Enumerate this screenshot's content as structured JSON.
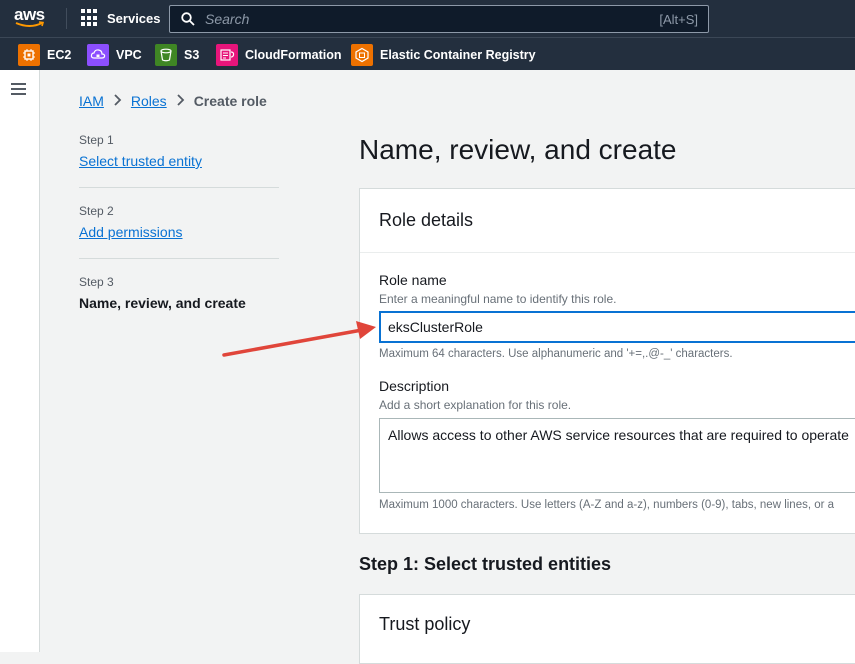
{
  "topbar": {
    "logo_text": "aws",
    "services_label": "Services",
    "search_placeholder": "Search",
    "search_shortcut": "[Alt+S]"
  },
  "favorites": [
    {
      "label": "EC2",
      "icon": "ec2-icon",
      "color": "#ed7100"
    },
    {
      "label": "VPC",
      "icon": "vpc-icon",
      "color": "#8c4fff"
    },
    {
      "label": "S3",
      "icon": "s3-icon",
      "color": "#3f8624"
    },
    {
      "label": "CloudFormation",
      "icon": "cloudformation-icon",
      "color": "#e7157b"
    },
    {
      "label": "Elastic Container Registry",
      "icon": "ecr-icon",
      "color": "#ed7100"
    }
  ],
  "breadcrumb": {
    "items": [
      "IAM",
      "Roles"
    ],
    "current": "Create role"
  },
  "wizard_steps": [
    {
      "num": "Step 1",
      "label": "Select trusted entity",
      "current": false
    },
    {
      "num": "Step 2",
      "label": "Add permissions",
      "current": false
    },
    {
      "num": "Step 3",
      "label": "Name, review, and create",
      "current": true
    }
  ],
  "main": {
    "title": "Name, review, and create",
    "role_details": {
      "heading": "Role details",
      "role_name_label": "Role name",
      "role_name_desc": "Enter a meaningful name to identify this role.",
      "role_name_value": "eksClusterRole",
      "role_name_hint": "Maximum 64 characters. Use alphanumeric and '+=,.@-_' characters.",
      "description_label": "Description",
      "description_desc": "Add a short explanation for this role.",
      "description_value": "Allows access to other AWS service resources that are required to operate",
      "description_hint": "Maximum 1000 characters. Use letters (A-Z and a-z), numbers (0-9), tabs, new lines, or a"
    },
    "step1_heading": "Step 1: Select trusted entities",
    "trust_policy_heading": "Trust policy"
  },
  "colors": {
    "topbar": "#232f3e",
    "link": "#0972d3",
    "annotation_arrow": "#e0453a"
  }
}
